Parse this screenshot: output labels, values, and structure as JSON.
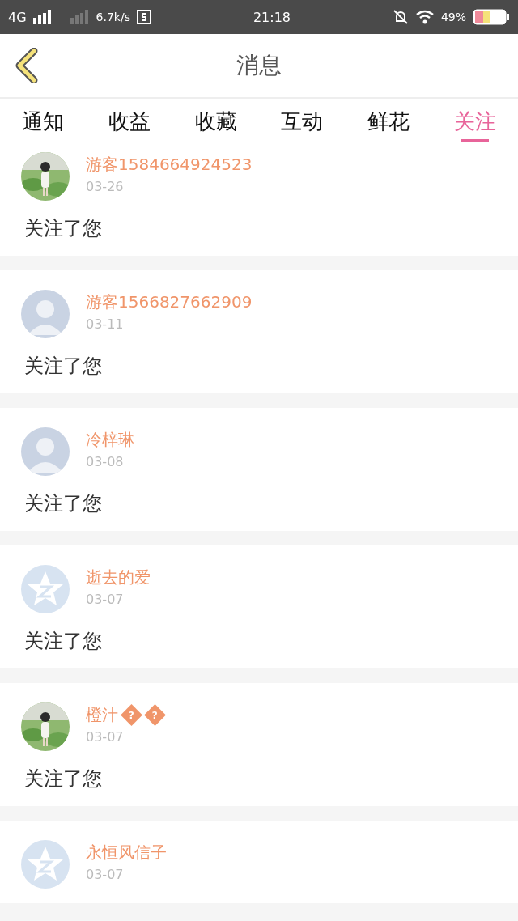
{
  "status_bar": {
    "network": "4G",
    "speed": "6.7k/s",
    "time": "21:18",
    "battery": "49%"
  },
  "header": {
    "title": "消息"
  },
  "tabs": [
    {
      "label": "通知",
      "selected": false
    },
    {
      "label": "收益",
      "selected": false
    },
    {
      "label": "收藏",
      "selected": false
    },
    {
      "label": "互动",
      "selected": false
    },
    {
      "label": "鲜花",
      "selected": false
    },
    {
      "label": "关注",
      "selected": true
    }
  ],
  "messages": [
    {
      "name": "游客1584664924523",
      "date": "03-26",
      "text": "关注了您"
    },
    {
      "kind": "person",
      "name": "游客1566827662909",
      "date": "03-11",
      "text": "关注了您"
    },
    {
      "kind": "person",
      "name": "冷梓琳",
      "date": "03-08",
      "text": "关注了您"
    },
    {
      "kind": "star",
      "name": "逝去的爱",
      "date": "03-07",
      "text": "关注了您"
    },
    {
      "name": "橙汁",
      "badges": [
        "?",
        "?"
      ],
      "date": "03-07",
      "text": "关注了您"
    },
    {
      "kind": "star",
      "name": "永恒风信子",
      "date": "03-07"
    }
  ]
}
